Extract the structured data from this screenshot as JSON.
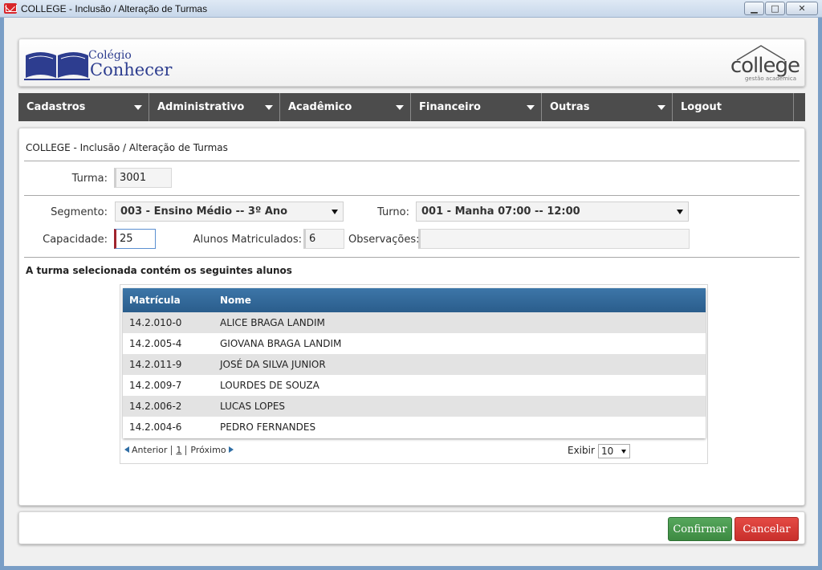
{
  "window": {
    "title": "COLLEGE - Inclusão / Alteração de Turmas",
    "min": "▁",
    "max": "□",
    "close": "✕"
  },
  "header": {
    "brand_line1": "Colégio",
    "brand_line2": "Conhecer",
    "partner_word": "college",
    "partner_sub": "gestão acadêmica"
  },
  "menu": {
    "items": [
      "Cadastros",
      "Administrativo",
      "Acadêmico",
      "Financeiro",
      "Outras",
      "Logout"
    ]
  },
  "form": {
    "title": "COLLEGE - Inclusão / Alteração de Turmas",
    "turma_label": "Turma:",
    "turma_value": "3001",
    "segmento_label": "Segmento:",
    "segmento_value": "003 - Ensino Médio -- 3º Ano",
    "turno_label": "Turno:",
    "turno_value": "001 - Manha 07:00 -- 12:00",
    "capacidade_label": "Capacidade:",
    "capacidade_value": "25",
    "alunos_label": "Alunos Matriculados:",
    "alunos_value": "6",
    "obs_label": "Observações:",
    "obs_value": ""
  },
  "students": {
    "title": "A turma selecionada contém os seguintes alunos",
    "columns": [
      "Matrícula",
      "Nome"
    ],
    "rows": [
      [
        "14.2.010-0",
        "ALICE BRAGA LANDIM"
      ],
      [
        "14.2.005-4",
        "GIOVANA BRAGA LANDIM"
      ],
      [
        "14.2.011-9",
        "JOSÉ DA SILVA JUNIOR"
      ],
      [
        "14.2.009-7",
        "LOURDES DE SOUZA"
      ],
      [
        "14.2.006-2",
        "LUCAS LOPES"
      ],
      [
        "14.2.004-6",
        "PEDRO FERNANDES"
      ]
    ],
    "pager": {
      "prev": "Anterior",
      "page": "1",
      "next": "Próximo",
      "show_label": "Exibir",
      "show_value": "10"
    }
  },
  "footer": {
    "confirm": "Confirmar",
    "cancel": "Cancelar"
  }
}
